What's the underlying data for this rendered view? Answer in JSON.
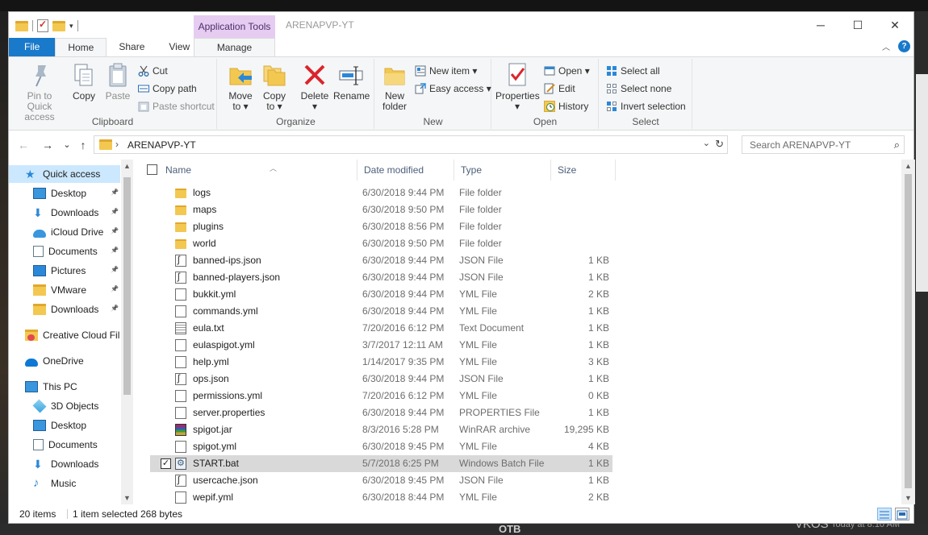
{
  "window": {
    "title": "ARENAPVP-YT",
    "context_tab": "Application Tools",
    "controls": {
      "minimize": "─",
      "maximize": "☐",
      "close": "✕"
    }
  },
  "ribbon_tabs": [
    "File",
    "Home",
    "Share",
    "View",
    "Manage"
  ],
  "ribbon": {
    "clipboard": {
      "group": "Clipboard",
      "pin": [
        "Pin to Quick",
        "access"
      ],
      "copy": "Copy",
      "paste": "Paste",
      "cut": "Cut",
      "copy_path": "Copy path",
      "paste_shortcut": "Paste shortcut"
    },
    "organize": {
      "group": "Organize",
      "move": [
        "Move",
        "to ▾"
      ],
      "copy_to": [
        "Copy",
        "to ▾"
      ],
      "delete": [
        "Delete",
        "▾"
      ],
      "rename": "Rename"
    },
    "new": {
      "group": "New",
      "new_folder": [
        "New",
        "folder"
      ],
      "new_item": "New item ▾",
      "easy_access": "Easy access ▾"
    },
    "open": {
      "group": "Open",
      "properties": [
        "Properties",
        "▾"
      ],
      "open": "Open ▾",
      "edit": "Edit",
      "history": "History"
    },
    "select": {
      "group": "Select",
      "select_all": "Select all",
      "select_none": "Select none",
      "invert": "Invert selection"
    }
  },
  "address": {
    "path": "ARENAPVP-YT",
    "search_placeholder": "Search ARENAPVP-YT",
    "back": "←",
    "forward": "→",
    "recent": "⌄",
    "up": "↑"
  },
  "nav_pane": [
    {
      "label": "Quick access",
      "icon": "star-icon",
      "color": "#2b88d8",
      "pinned": false,
      "selected": true
    },
    {
      "label": "Desktop",
      "icon": "desktop-icon",
      "color": "#3a96dd",
      "pinned": true
    },
    {
      "label": "Downloads",
      "icon": "download-arrow-icon",
      "color": "#2b88d8",
      "pinned": true
    },
    {
      "label": "iCloud Drive",
      "icon": "cloud-icon",
      "color": "#3a96dd",
      "pinned": true
    },
    {
      "label": "Documents",
      "icon": "documents-icon",
      "color": "#607d8b",
      "pinned": true
    },
    {
      "label": "Pictures",
      "icon": "pictures-icon",
      "color": "#2b88d8",
      "pinned": true
    },
    {
      "label": "VMware",
      "icon": "folder-icon",
      "color": "#f3c851",
      "pinned": true
    },
    {
      "label": "Downloads",
      "icon": "folder-icon",
      "color": "#f3c851",
      "pinned": true
    },
    {
      "label": "Creative Cloud Fil",
      "icon": "creative-cloud-icon",
      "color": "#e34850",
      "pinned": false
    },
    {
      "label": "OneDrive",
      "icon": "onedrive-icon",
      "color": "#0f78d4",
      "pinned": false
    },
    {
      "label": "This PC",
      "icon": "computer-icon",
      "color": "#3a96dd",
      "pinned": false
    },
    {
      "label": "3D Objects",
      "icon": "cube-icon",
      "color": "#3aa4dd",
      "pinned": false
    },
    {
      "label": "Desktop",
      "icon": "desktop-icon",
      "color": "#3a96dd",
      "pinned": false
    },
    {
      "label": "Documents",
      "icon": "documents-icon",
      "color": "#607d8b",
      "pinned": false
    },
    {
      "label": "Downloads",
      "icon": "download-arrow-icon",
      "color": "#2b88d8",
      "pinned": false
    },
    {
      "label": "Music",
      "icon": "music-icon",
      "color": "#2b88d8",
      "pinned": false
    }
  ],
  "columns": {
    "name": "Name",
    "date": "Date modified",
    "type": "Type",
    "size": "Size"
  },
  "files": [
    {
      "name": "logs",
      "date": "6/30/2018 9:44 PM",
      "type": "File folder",
      "size": "",
      "icon": "folder"
    },
    {
      "name": "maps",
      "date": "6/30/2018 9:50 PM",
      "type": "File folder",
      "size": "",
      "icon": "folder"
    },
    {
      "name": "plugins",
      "date": "6/30/2018 8:56 PM",
      "type": "File folder",
      "size": "",
      "icon": "folder"
    },
    {
      "name": "world",
      "date": "6/30/2018 9:50 PM",
      "type": "File folder",
      "size": "",
      "icon": "folder"
    },
    {
      "name": "banned-ips.json",
      "date": "6/30/2018 9:44 PM",
      "type": "JSON File",
      "size": "1 KB",
      "icon": "json"
    },
    {
      "name": "banned-players.json",
      "date": "6/30/2018 9:44 PM",
      "type": "JSON File",
      "size": "1 KB",
      "icon": "json"
    },
    {
      "name": "bukkit.yml",
      "date": "6/30/2018 9:44 PM",
      "type": "YML File",
      "size": "2 KB",
      "icon": "doc"
    },
    {
      "name": "commands.yml",
      "date": "6/30/2018 9:44 PM",
      "type": "YML File",
      "size": "1 KB",
      "icon": "doc"
    },
    {
      "name": "eula.txt",
      "date": "7/20/2016 6:12 PM",
      "type": "Text Document",
      "size": "1 KB",
      "icon": "txt"
    },
    {
      "name": "eulaspigot.yml",
      "date": "3/7/2017 12:11 AM",
      "type": "YML File",
      "size": "1 KB",
      "icon": "doc"
    },
    {
      "name": "help.yml",
      "date": "1/14/2017 9:35 PM",
      "type": "YML File",
      "size": "3 KB",
      "icon": "doc"
    },
    {
      "name": "ops.json",
      "date": "6/30/2018 9:44 PM",
      "type": "JSON File",
      "size": "1 KB",
      "icon": "json"
    },
    {
      "name": "permissions.yml",
      "date": "7/20/2016 6:12 PM",
      "type": "YML File",
      "size": "0 KB",
      "icon": "doc"
    },
    {
      "name": "server.properties",
      "date": "6/30/2018 9:44 PM",
      "type": "PROPERTIES File",
      "size": "1 KB",
      "icon": "doc"
    },
    {
      "name": "spigot.jar",
      "date": "8/3/2016 5:28 PM",
      "type": "WinRAR archive",
      "size": "19,295 KB",
      "icon": "rar"
    },
    {
      "name": "spigot.yml",
      "date": "6/30/2018 9:45 PM",
      "type": "YML File",
      "size": "4 KB",
      "icon": "doc"
    },
    {
      "name": "START.bat",
      "date": "5/7/2018 6:25 PM",
      "type": "Windows Batch File",
      "size": "1 KB",
      "icon": "bat",
      "selected": true
    },
    {
      "name": "usercache.json",
      "date": "6/30/2018 9:45 PM",
      "type": "JSON File",
      "size": "1 KB",
      "icon": "json"
    },
    {
      "name": "wepif.yml",
      "date": "6/30/2018 8:44 PM",
      "type": "YML File",
      "size": "2 KB",
      "icon": "doc"
    }
  ],
  "status": {
    "items": "20 items",
    "selected": "1 item selected",
    "size": "268 bytes"
  },
  "taskbar": {
    "otb": "OTB",
    "vkos": "VKOS",
    "today": "Today at 8:10 AM"
  }
}
